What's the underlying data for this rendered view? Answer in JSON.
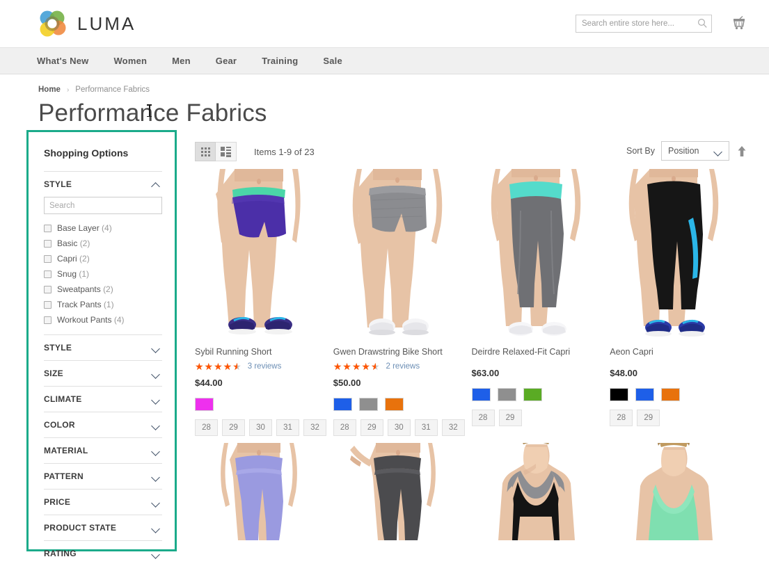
{
  "header": {
    "logo_text": "LUMA",
    "logo_icon": "luma-flower-logo",
    "search_placeholder": "Search entire store here...",
    "search_value": "",
    "search_icon": "search-icon",
    "cart_icon": "shopping-cart-icon"
  },
  "nav": {
    "items": [
      {
        "label": "What's New"
      },
      {
        "label": "Women"
      },
      {
        "label": "Men"
      },
      {
        "label": "Gear"
      },
      {
        "label": "Training"
      },
      {
        "label": "Sale"
      }
    ]
  },
  "breadcrumb": {
    "home": "Home",
    "separator": "›",
    "current": "Performance Fabrics"
  },
  "page": {
    "title": "Performance Fabrics"
  },
  "sidebar": {
    "title": "Shopping Options",
    "expanded_filter": {
      "name": "STYLE",
      "chevron": "chevron-up-icon",
      "search_placeholder": "Search",
      "search_value": "",
      "options": [
        {
          "label": "Base Layer",
          "count": "(4)"
        },
        {
          "label": "Basic",
          "count": "(2)"
        },
        {
          "label": "Capri",
          "count": "(2)"
        },
        {
          "label": "Snug",
          "count": "(1)"
        },
        {
          "label": "Sweatpants",
          "count": "(2)"
        },
        {
          "label": "Track Pants",
          "count": "(1)"
        },
        {
          "label": "Workout Pants",
          "count": "(4)"
        }
      ]
    },
    "collapsed_filters": [
      {
        "name": "STYLE",
        "chevron": "chevron-down-icon"
      },
      {
        "name": "SIZE",
        "chevron": "chevron-down-icon"
      },
      {
        "name": "CLIMATE",
        "chevron": "chevron-down-icon"
      },
      {
        "name": "COLOR",
        "chevron": "chevron-down-icon"
      },
      {
        "name": "MATERIAL",
        "chevron": "chevron-down-icon"
      },
      {
        "name": "PATTERN",
        "chevron": "chevron-down-icon"
      },
      {
        "name": "PRICE",
        "chevron": "chevron-down-icon"
      },
      {
        "name": "PRODUCT STATE",
        "chevron": "chevron-down-icon"
      },
      {
        "name": "RATING",
        "chevron": "chevron-down-icon"
      }
    ],
    "highlight_color": "#1bab8a"
  },
  "toolbar": {
    "grid_view_icon": "grid-view-icon",
    "list_view_icon": "list-view-icon",
    "active_view": "grid",
    "items_count": "Items 1-9 of 23",
    "sort_label": "Sort By",
    "sort_value": "Position",
    "sort_chevron": "chevron-down-icon",
    "sort_direction_icon": "arrow-up-icon"
  },
  "products": [
    {
      "name": "Sybil Running Short",
      "rating_percent": 90,
      "reviews": "3 reviews",
      "price": "$44.00",
      "swatches": [
        "#ee30ee"
      ],
      "sizes": [
        "28",
        "29",
        "30",
        "31",
        "32"
      ],
      "image": "purple-running-shorts-green-waistband"
    },
    {
      "name": "Gwen Drawstring Bike Short",
      "rating_percent": 90,
      "reviews": "2 reviews",
      "price": "$50.00",
      "swatches": [
        "#1e5fe8",
        "#8f8f8f",
        "#e8720c"
      ],
      "sizes": [
        "28",
        "29",
        "30",
        "31",
        "32"
      ],
      "image": "gray-heather-bike-shorts"
    },
    {
      "name": "Deirdre Relaxed-Fit Capri",
      "rating_percent": 0,
      "reviews": "",
      "price": "$63.00",
      "swatches": [
        "#1e5fe8",
        "#8f8f8f",
        "#5aab24"
      ],
      "sizes": [
        "28",
        "29"
      ],
      "image": "gray-capri-leggings-teal-waistband"
    },
    {
      "name": "Aeon Capri",
      "rating_percent": 0,
      "reviews": "",
      "price": "$48.00",
      "swatches": [
        "#000000",
        "#1e5fe8",
        "#e8720c"
      ],
      "sizes": [
        "28",
        "29"
      ],
      "image": "black-capri-leggings-blue-stripe"
    }
  ],
  "products_row2": [
    {
      "image": "light-purple-leggings"
    },
    {
      "image": "dark-gray-leggings"
    },
    {
      "image": "black-tank-top-gray-straps"
    },
    {
      "image": "mint-green-tank-top"
    }
  ],
  "colors": {
    "accent_star": "#ff5501",
    "nav_bg": "#f0f0f0",
    "link": "#6d8fb5",
    "highlight": "#1bab8a"
  }
}
